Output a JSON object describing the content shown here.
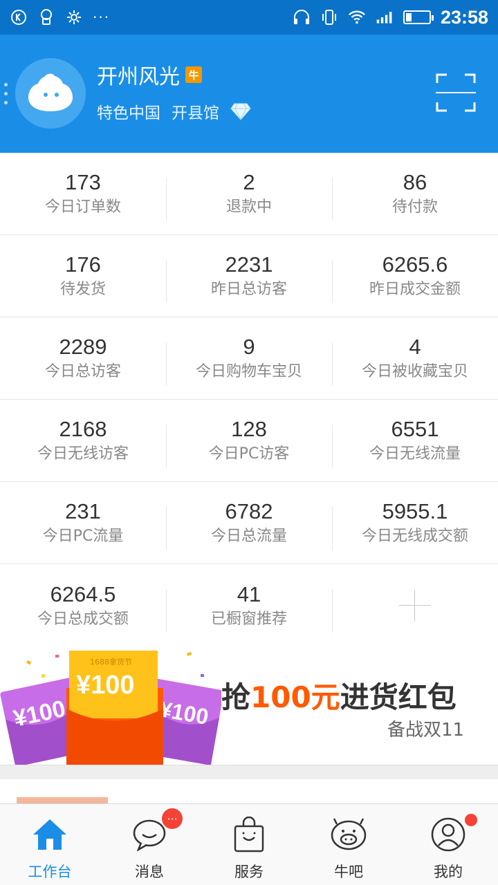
{
  "status_bar": {
    "time": "23:58",
    "menu_dots": "···",
    "icons": [
      "k-icon",
      "headset-user-icon",
      "gear-icon",
      "headphones-icon",
      "vibrate-icon",
      "wifi-icon",
      "signal-icon",
      "battery-icon"
    ]
  },
  "header": {
    "shop_name": "开州风光",
    "badge": "牛",
    "sub_title": "特色中国",
    "sub_hall": "开县馆",
    "accent_color": "#1a8ee6"
  },
  "stats": [
    [
      {
        "value": "173",
        "label": "今日订单数"
      },
      {
        "value": "2",
        "label": "退款中"
      },
      {
        "value": "86",
        "label": "待付款"
      }
    ],
    [
      {
        "value": "176",
        "label": "待发货"
      },
      {
        "value": "2231",
        "label": "昨日总访客"
      },
      {
        "value": "6265.6",
        "label": "昨日成交金额"
      }
    ],
    [
      {
        "value": "2289",
        "label": "今日总访客"
      },
      {
        "value": "9",
        "label": "今日购物车宝贝"
      },
      {
        "value": "4",
        "label": "今日被收藏宝贝"
      }
    ],
    [
      {
        "value": "2168",
        "label": "今日无线访客"
      },
      {
        "value": "128",
        "label": "今日PC访客"
      },
      {
        "value": "6551",
        "label": "今日无线流量"
      }
    ],
    [
      {
        "value": "231",
        "label": "今日PC流量"
      },
      {
        "value": "6782",
        "label": "今日总流量"
      },
      {
        "value": "5955.1",
        "label": "今日无线成交额"
      }
    ],
    [
      {
        "value": "6264.5",
        "label": "今日总成交额"
      },
      {
        "value": "41",
        "label": "已橱窗推荐"
      }
    ]
  ],
  "banner": {
    "title_prefix": "抢",
    "title_highlight": "100元",
    "title_suffix": "进货红包",
    "subtitle": "备战双11",
    "envelope_amount": "¥100",
    "envelope_tag": "1688拿货节"
  },
  "tabs": [
    {
      "label": "工作台",
      "icon": "home-icon",
      "active": true
    },
    {
      "label": "消息",
      "icon": "chat-bubble-icon",
      "badge": "···"
    },
    {
      "label": "服务",
      "icon": "shopping-bag-icon"
    },
    {
      "label": "牛吧",
      "icon": "cow-icon"
    },
    {
      "label": "我的",
      "icon": "user-icon",
      "dot": true
    }
  ]
}
